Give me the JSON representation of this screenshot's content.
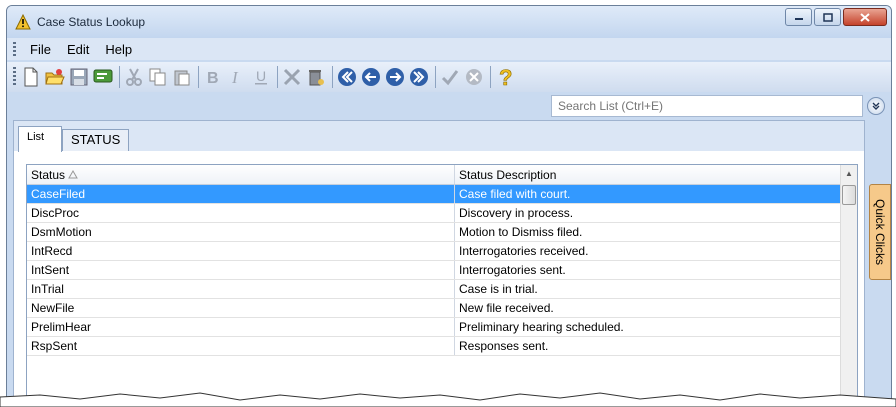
{
  "window": {
    "title": "Case Status Lookup"
  },
  "menu": {
    "items": [
      "File",
      "Edit",
      "Help"
    ]
  },
  "toolbar": {
    "buttons": [
      "new-icon",
      "open-icon",
      "save-icon",
      "comment-icon",
      "cut-icon",
      "copy-icon",
      "paste-icon",
      "bold-icon",
      "italic-icon",
      "underline-icon",
      "tools-icon",
      "delete-icon",
      "first-record-icon",
      "previous-record-icon",
      "next-record-icon",
      "last-record-icon",
      "check-icon",
      "cancel-icon",
      "help-icon"
    ]
  },
  "search": {
    "placeholder": "Search List (Ctrl+E)"
  },
  "tabs": {
    "list": "List",
    "status": "STATUS"
  },
  "grid": {
    "headers": {
      "status": "Status",
      "description": "Status Description"
    },
    "rows": [
      {
        "status": "CaseFiled",
        "description": "Case filed with court."
      },
      {
        "status": "DiscProc",
        "description": "Discovery in process."
      },
      {
        "status": "DsmMotion",
        "description": "Motion to Dismiss filed."
      },
      {
        "status": "IntRecd",
        "description": "Interrogatories received."
      },
      {
        "status": "IntSent",
        "description": "Interrogatories sent."
      },
      {
        "status": "InTrial",
        "description": "Case is in trial."
      },
      {
        "status": "NewFile",
        "description": "New file received."
      },
      {
        "status": "PrelimHear",
        "description": "Preliminary hearing scheduled."
      },
      {
        "status": "RspSent",
        "description": "Responses sent."
      }
    ],
    "selected_index": 0
  },
  "side_panel": {
    "label": "Quick Clicks"
  },
  "colors": {
    "selection": "#3399ff",
    "accent": "#c9daf0",
    "quick_clicks": "#f6c98a"
  }
}
